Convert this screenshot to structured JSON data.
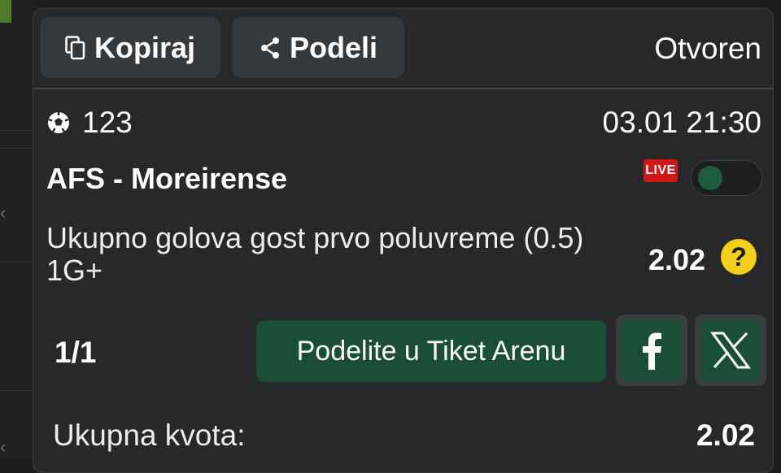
{
  "ticket": {
    "copy_label": "Kopiraj",
    "share_label": "Podeli",
    "status": "Otvoren"
  },
  "event": {
    "id": "123",
    "datetime": "03.01 21:30",
    "match": "AFS - Moreirense",
    "live_badge": "LIVE",
    "market": "Ukupno golova gost prvo poluvreme (0.5) 1G+",
    "odd": "2.02",
    "help_symbol": "?"
  },
  "footer": {
    "count": "1/1",
    "arena_button": "Podelite u Tiket Arenu",
    "total_label": "Ukupna kvota:",
    "total_value": "2.02"
  },
  "icons": {
    "copy": "copy-icon",
    "share": "share-icon",
    "sport": "soccer-ball-icon",
    "facebook": "facebook-icon",
    "x": "x-icon"
  },
  "colors": {
    "panel_bg": "#262829",
    "button_bg": "#36393b",
    "accent_green": "#1a4e36",
    "live_red": "#d01818",
    "help_yellow": "#f2cf1b"
  }
}
